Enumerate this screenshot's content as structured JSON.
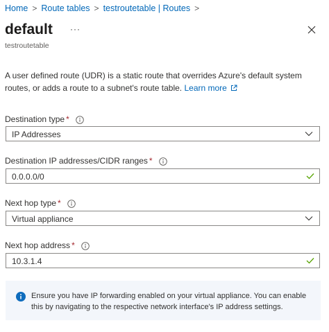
{
  "breadcrumb": {
    "items": [
      "Home",
      "Route tables",
      "testroutetable | Routes"
    ],
    "separator": ">"
  },
  "header": {
    "title": "default",
    "more": "···",
    "subtitle": "testroutetable"
  },
  "description": {
    "text": "A user defined route (UDR) is a static route that overrides Azure's default system routes, or adds a route to a subnet's route table.",
    "link": "Learn more"
  },
  "form": {
    "destination_type": {
      "label": "Destination type",
      "required": "*",
      "value": "IP Addresses"
    },
    "destination_ip": {
      "label": "Destination IP addresses/CIDR ranges",
      "required": "*",
      "value": "0.0.0.0/0"
    },
    "next_hop_type": {
      "label": "Next hop type",
      "required": "*",
      "value": "Virtual appliance"
    },
    "next_hop_address": {
      "label": "Next hop address",
      "required": "*",
      "value": "10.3.1.4"
    }
  },
  "notice": {
    "text": "Ensure you have IP forwarding enabled on your virtual appliance. You can enable this by navigating to the respective network interface's IP address settings."
  },
  "colors": {
    "link": "#0067b8",
    "required": "#a4262c",
    "valid": "#57a300",
    "info": "#0f6cbd",
    "notice_bg": "#f3f6fb"
  }
}
